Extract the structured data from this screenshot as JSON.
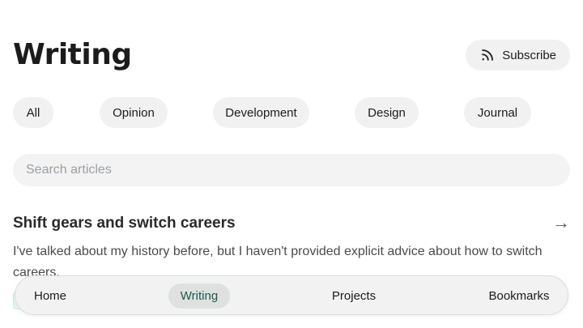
{
  "header": {
    "title": "Writing",
    "subscribe_label": "Subscribe",
    "subscribe_icon": "rss-icon"
  },
  "filters": [
    "All",
    "Opinion",
    "Development",
    "Design",
    "Journal"
  ],
  "search": {
    "placeholder": "Search articles",
    "value": ""
  },
  "article": {
    "title": "Shift gears and switch careers",
    "excerpt": "I've talked about my history before, but I haven't provided explicit advice about how to switch careers.",
    "arrow": "→"
  },
  "bottom_nav": {
    "items": [
      "Home",
      "Writing",
      "Projects",
      "Bookmarks"
    ],
    "active": "Writing"
  },
  "colors": {
    "chip_bg": "#f1f1f1",
    "active_nav_text": "#1f5a4d",
    "tag_bg": "#e6f7f3"
  }
}
